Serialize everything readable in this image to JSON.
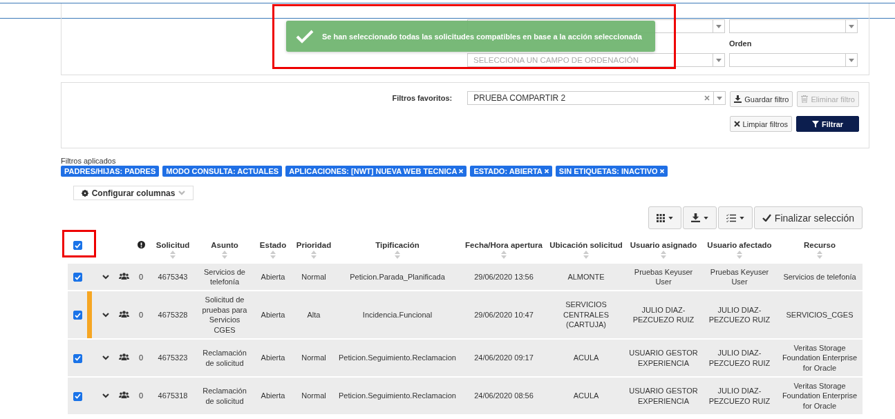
{
  "toast": {
    "message": "Se han seleccionado todas las solicitudes compatibles en base a la acción seleccionada"
  },
  "ordering": {
    "secondary_placeholder": "SELECCIONA UN CAMPO DE ORDENACIÓN",
    "order_label": "Orden"
  },
  "favorites": {
    "label": "Filtros favoritos:",
    "value": "PRUEBA COMPARTIR 2",
    "save": "Guardar filtro",
    "delete": {
      "label": "Eliminar filtro",
      "disabled": true
    },
    "clear": "Limpiar filtros",
    "filter": "Filtrar"
  },
  "applied_filters": {
    "label": "Filtros aplicados",
    "tags": [
      {
        "text": "PADRES/HIJAS: PADRES",
        "removable": false
      },
      {
        "text": "MODO CONSULTA: ACTUALES",
        "removable": false
      },
      {
        "text": "APLICACIONES: [NWT] NUEVA WEB TECNICA",
        "removable": true
      },
      {
        "text": "ESTADO: ABIERTA",
        "removable": true
      },
      {
        "text": "SIN ETIQUETAS: INACTIVO",
        "removable": true
      }
    ]
  },
  "configure_columns": "Configurar columnas",
  "toolbar": {
    "finish": "Finalizar selección"
  },
  "table": {
    "select_all_checked": true,
    "columns": [
      "Solicitud",
      "Asunto",
      "Estado",
      "Prioridad",
      "Tipificación",
      "Fecha/Hora apertura",
      "Ubicación solicitud",
      "Usuario asignado",
      "Usuario afectado",
      "Recurso"
    ],
    "rows": [
      {
        "checked": true,
        "flagged": false,
        "count": "0",
        "cells": [
          "4675343",
          "Servicios de telefonía",
          "Abierta",
          "Normal",
          "Peticion.Parada_Planificada",
          "29/06/2020 13:56",
          "ALMONTE",
          "Pruebas Keyuser User",
          "Pruebas Keyuser User",
          "Servicios de telefonía"
        ]
      },
      {
        "checked": true,
        "flagged": true,
        "count": "0",
        "cells": [
          "4675328",
          "Solicitud de pruebas para Servicios CGES",
          "Abierta",
          "Alta",
          "Incidencia.Funcional",
          "29/06/2020 10:47",
          "SERVICIOS CENTRALES (CARTUJA)",
          "JULIO DIAZ-PEZCUEZO RUIZ",
          "JULIO DIAZ-PEZCUEZO RUIZ",
          "SERVICIOS_CGES"
        ]
      },
      {
        "checked": true,
        "flagged": false,
        "count": "0",
        "cells": [
          "4675323",
          "Reclamación de solicitud",
          "Abierta",
          "Normal",
          "Peticion.Seguimiento.Reclamacion",
          "24/06/2020 09:17",
          "ACULA",
          "USUARIO GESTOR EXPERIENCIA",
          "JULIO DIAZ-PEZCUEZO RUIZ",
          "Veritas Storage Foundation Enterprise for Oracle"
        ]
      },
      {
        "checked": true,
        "flagged": false,
        "count": "0",
        "cells": [
          "4675318",
          "Reclamación de solicitud",
          "Abierta",
          "Normal",
          "Peticion.Seguimiento.Reclamacion",
          "24/06/2020 08:56",
          "ACULA",
          "USUARIO GESTOR EXPERIENCIA",
          "JULIO DIAZ-PEZCUEZO RUIZ",
          "Veritas Storage Foundation Enterprise for Oracle"
        ]
      }
    ]
  }
}
